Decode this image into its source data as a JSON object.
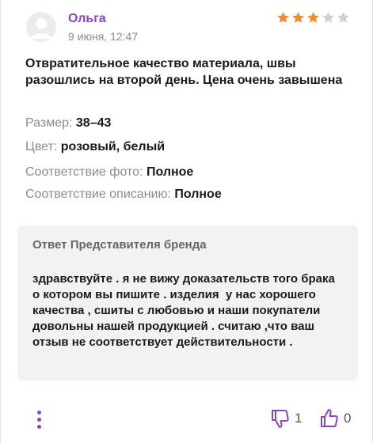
{
  "review": {
    "author": "Ольга",
    "date": "9 июня, 12:47",
    "rating": 3,
    "rating_max": 5,
    "text": "Отвратительное качество материала, швы разошлись на второй день. Цена очень завышена",
    "attributes": [
      {
        "label": "Размер:",
        "value": "38–43"
      },
      {
        "label": "Цвет:",
        "value": "розовый, белый"
      },
      {
        "label": "Соответствие фото:",
        "value": "Полное"
      },
      {
        "label": "Соответствие описанию:",
        "value": "Полное"
      }
    ]
  },
  "reply": {
    "title": "Ответ Представителя бренда",
    "text": "здравствуйте . я не вижу доказательств того брака о котором вы пишите . изделия  у нас хорошего качества , сшиты с любовью и наши покупатели довольны нашей продукцией . считаю ,что ваш отзыв не соответствует действительности ."
  },
  "actions": {
    "dislike_count": "1",
    "like_count": "0"
  },
  "colors": {
    "accent": "#8b45b8",
    "star_filled": "#f08c2f",
    "star_empty": "#cfcfcf",
    "reply_bg": "#f2f2f2"
  },
  "icons": {
    "menu": "vertical-dots-icon",
    "dislike": "thumbs-down-icon",
    "like": "thumbs-up-icon",
    "avatar": "user-avatar-placeholder-icon"
  }
}
